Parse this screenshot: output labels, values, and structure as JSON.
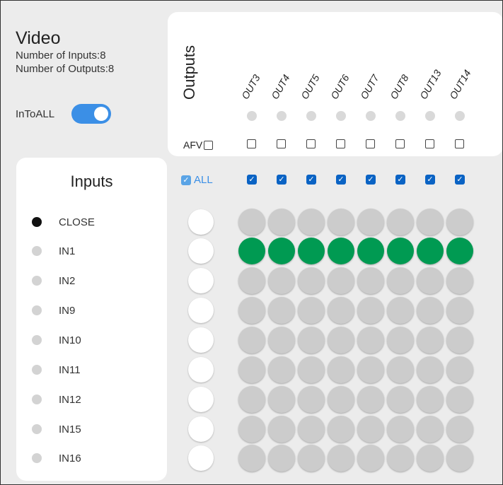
{
  "video": {
    "title": "Video",
    "num_inputs_text": "Number of Inputs:8",
    "num_outputs_text": "Number of Outputs:8",
    "into_all_label": "InToALL",
    "into_all_on": true
  },
  "outputs": {
    "title": "Outputs",
    "afv_label": "AFV",
    "all_label": "ALL",
    "labels": [
      "OUT3",
      "OUT4",
      "OUT5",
      "OUT6",
      "OUT7",
      "OUT8",
      "OUT13",
      "OUT14"
    ]
  },
  "inputs": {
    "title": "Inputs",
    "items": [
      {
        "label": "CLOSE",
        "active": true
      },
      {
        "label": "IN1",
        "active": false
      },
      {
        "label": "IN2",
        "active": false
      },
      {
        "label": "IN9",
        "active": false
      },
      {
        "label": "IN10",
        "active": false
      },
      {
        "label": "IN11",
        "active": false
      },
      {
        "label": "IN12",
        "active": false
      },
      {
        "label": "IN15",
        "active": false
      },
      {
        "label": "IN16",
        "active": false
      }
    ]
  },
  "matrix": {
    "routed_row": 1
  },
  "colors": {
    "accent": "#3b8fe6",
    "routed": "#009a52",
    "idle": "#cccccc"
  }
}
